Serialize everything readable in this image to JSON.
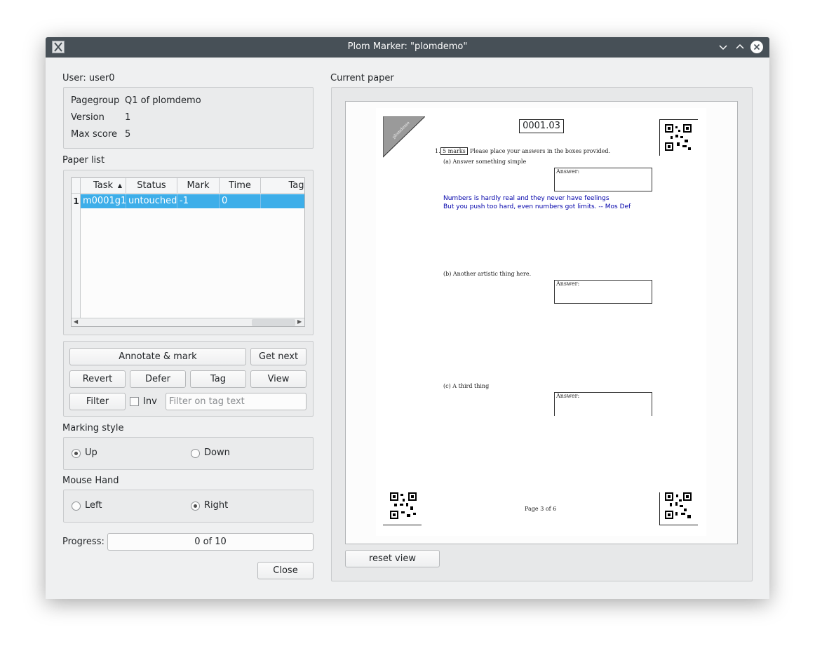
{
  "window": {
    "title": "Plom Marker: \"plomdemo\""
  },
  "user_label": "User: user0",
  "info": {
    "pagegroup_label": "Pagegroup",
    "pagegroup_value": "Q1 of plomdemo",
    "version_label": "Version",
    "version_value": "1",
    "maxscore_label": "Max score",
    "maxscore_value": "5"
  },
  "paper_list": {
    "title": "Paper list",
    "columns": [
      "Task",
      "Status",
      "Mark",
      "Time",
      "Tag"
    ],
    "rows": [
      {
        "num": "1",
        "task": "m0001g1",
        "status": "untouched",
        "mark": "-1",
        "time": "0",
        "tag": ""
      }
    ]
  },
  "buttons": {
    "annotate": "Annotate & mark",
    "get_next": "Get next",
    "revert": "Revert",
    "defer": "Defer",
    "tag": "Tag",
    "view": "View",
    "filter": "Filter",
    "inv": "Inv",
    "close": "Close",
    "reset_view": "reset view"
  },
  "filter_placeholder": "Filter on tag text",
  "marking_style": {
    "title": "Marking style",
    "up": "Up",
    "down": "Down",
    "selected": "Up"
  },
  "mouse_hand": {
    "title": "Mouse Hand",
    "left": "Left",
    "right": "Right",
    "selected": "Right"
  },
  "progress": {
    "label": "Progress:",
    "text": "0 of 10",
    "value": 0
  },
  "current_paper": {
    "title": "Current paper",
    "page": {
      "code": "0001.03",
      "corner_stamp": "plomdemo",
      "question_marks": "5 marks",
      "question_text": "Please place your answers in the boxes provided.",
      "q_number": "1.",
      "part_a": "(a)  Answer something simple",
      "part_b": "(b)  Another artistic thing here.",
      "part_c": "(c)  A third thing",
      "answer_label": "Answer:",
      "handwriting_line1": "Numbers is hardly real and they never have feelings",
      "handwriting_line2": "But you push too hard, even numbers got limits.  -- Mos Def",
      "footer": "Page 3 of 6"
    }
  },
  "colors": {
    "selection": "#3daee9",
    "titlebar": "#475057",
    "handwriting": "#0000aa"
  }
}
